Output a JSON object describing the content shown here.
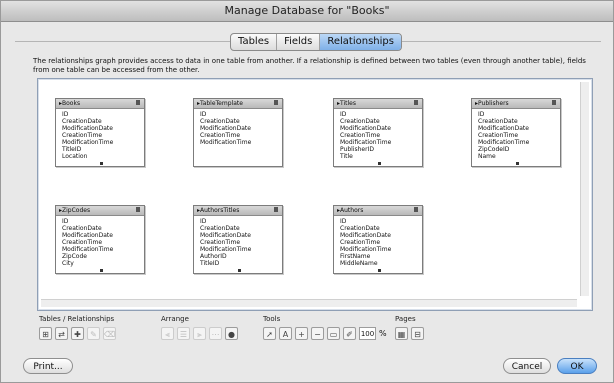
{
  "window": {
    "title": "Manage Database for \"Books\""
  },
  "tabs": [
    {
      "label": "Tables",
      "active": false
    },
    {
      "label": "Fields",
      "active": false
    },
    {
      "label": "Relationships",
      "active": true
    }
  ],
  "description": "The relationships graph provides access to data in one table from another. If a relationship is defined between two tables (even through another table), fields from one table can be accessed from the other.",
  "tables": [
    {
      "name": "Books",
      "fields": [
        "ID",
        "CreationDate",
        "ModificationDate",
        "CreationTime",
        "ModificationTime",
        "TitleID",
        "Location"
      ]
    },
    {
      "name": "TableTemplate",
      "fields": [
        "ID",
        "CreationDate",
        "ModificationDate",
        "CreationTime",
        "ModificationTime"
      ]
    },
    {
      "name": "Titles",
      "fields": [
        "ID",
        "CreationDate",
        "ModificationDate",
        "CreationTime",
        "ModificationTime",
        "PublisherID",
        "Title"
      ]
    },
    {
      "name": "Publishers",
      "fields": [
        "ID",
        "CreationDate",
        "ModificationDate",
        "CreationTime",
        "ModificationTime",
        "ZipCodeID",
        "Name"
      ]
    },
    {
      "name": "ZipCodes",
      "fields": [
        "ID",
        "CreationDate",
        "ModificationDate",
        "CreationTime",
        "ModificationTime",
        "ZipCode",
        "City"
      ]
    },
    {
      "name": "AuthorsTitles",
      "fields": [
        "ID",
        "CreationDate",
        "ModificationDate",
        "CreationTime",
        "ModificationTime",
        "AuthorID",
        "TitleID"
      ]
    },
    {
      "name": "Authors",
      "fields": [
        "ID",
        "CreationDate",
        "ModificationDate",
        "CreationTime",
        "ModificationTime",
        "FirstName",
        "MiddleName"
      ]
    }
  ],
  "toolbar": {
    "groups": {
      "tables_relationships": "Tables / Relationships",
      "arrange": "Arrange",
      "tools": "Tools",
      "pages": "Pages"
    },
    "zoom_value": "100",
    "zoom_unit": "%"
  },
  "buttons": {
    "print": "Print...",
    "cancel": "Cancel",
    "ok": "OK"
  },
  "colors": {
    "accent": "#7fb0e8",
    "default_button": "#5aa0ea"
  }
}
